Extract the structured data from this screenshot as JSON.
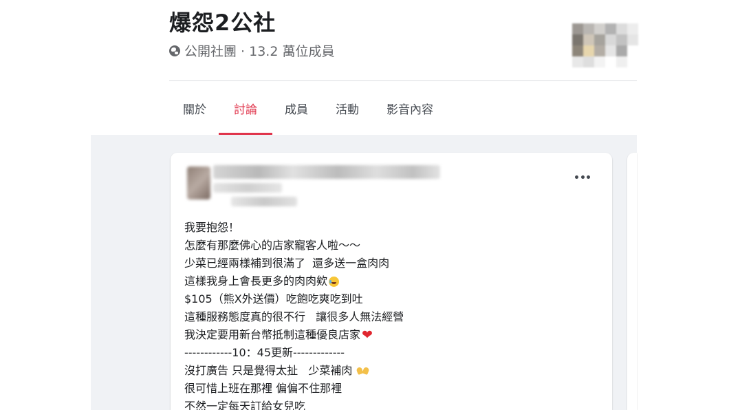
{
  "group": {
    "name": "爆怨2公社",
    "meta": "公開社團 · 13.2 萬位成員"
  },
  "tabs": [
    {
      "label": "關於",
      "active": false
    },
    {
      "label": "討論",
      "active": true
    },
    {
      "label": "成員",
      "active": false
    },
    {
      "label": "活動",
      "active": false
    },
    {
      "label": "影音內容",
      "active": false
    }
  ],
  "post": {
    "lines": [
      "我要抱怨！",
      "怎麼有那麼佛心的店家寵客人啦～～",
      "少菜已經兩樣補到很滿了  還多送一盒肉肉",
      "這樣我身上會長更多的肉肉欸",
      "$105（熊X外送價）吃飽吃爽吃到吐",
      "這種服務態度真的很不行   讓很多人無法經營",
      "我決定要用新台幣抵制這種優良店家",
      "------------10：45更新-------------",
      "沒打廣告 只是覺得太扯   少菜補肉",
      "很可惜上班在那裡 偏偏不住那裡",
      "不然一定每天訂給女兒吃"
    ]
  },
  "colors": {
    "accent": "#e0344b",
    "feed_background": "#f0f2f5",
    "heart": "#e0262f"
  },
  "icons": [
    "globe-icon",
    "more-options-icon",
    "laughing-tears-icon",
    "red-heart-icon",
    "raised-hands-icon"
  ]
}
